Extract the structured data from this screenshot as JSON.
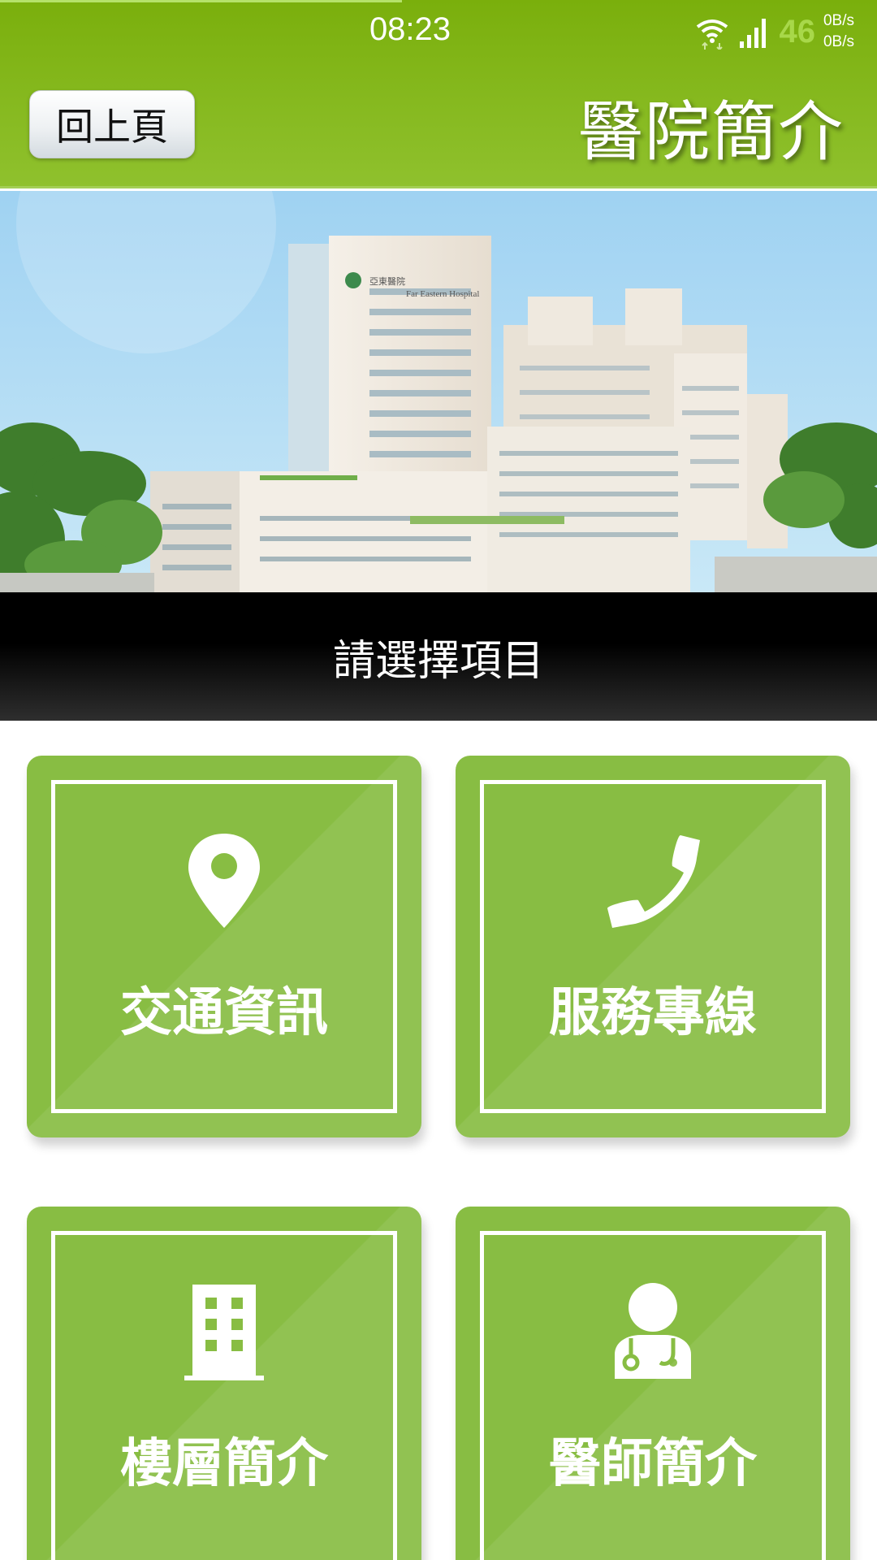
{
  "status_bar": {
    "time": "08:23",
    "network_badge": "46",
    "speed_up": "0B/s",
    "speed_down": "0B/s",
    "icons": [
      "wifi-icon",
      "cellular-signal-icon"
    ]
  },
  "header": {
    "back_label": "回上頁",
    "title": "醫院簡介"
  },
  "hero": {
    "sign_chinese": "亞東醫院",
    "sign_english": "Far Eastern Hospital"
  },
  "prompt": "請選擇項目",
  "menu": [
    {
      "label": "交通資訊",
      "icon": "map-pin-icon"
    },
    {
      "label": "服務專線",
      "icon": "phone-icon"
    },
    {
      "label": "樓層簡介",
      "icon": "building-icon"
    },
    {
      "label": "醫師簡介",
      "icon": "doctor-icon"
    }
  ],
  "colors": {
    "header_green": "#7aaf0c",
    "tile_green": "#88bd43",
    "prompt_band": "#000000"
  }
}
